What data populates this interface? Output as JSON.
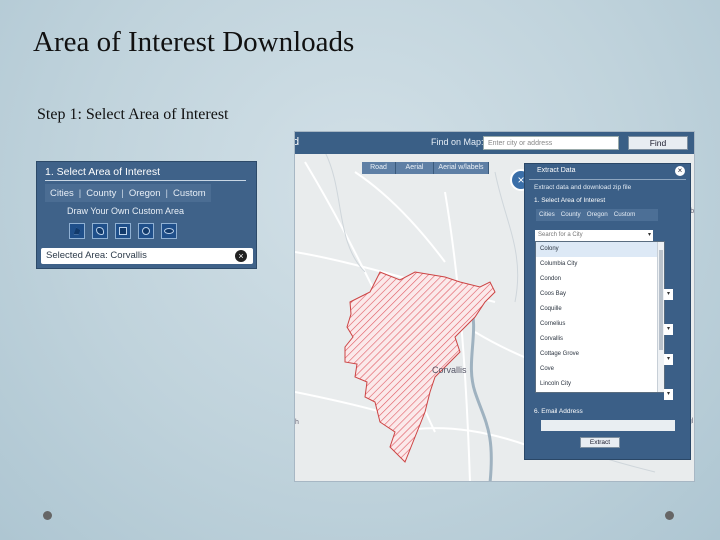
{
  "slide": {
    "title": "Area of Interest Downloads",
    "step": "Step 1: Select Area of Interest"
  },
  "snippet": {
    "header": "1. Select Area of Interest",
    "tabs": [
      "Cities",
      "County",
      "Oregon",
      "Custom"
    ],
    "draw_label": "Draw Your Own Custom Area",
    "tools": [
      "polygon-tool-icon",
      "freehand-tool-icon",
      "rectangle-tool-icon",
      "circle-tool-icon",
      "ellipse-tool-icon"
    ],
    "selected": "Selected Area: Corvallis",
    "clear": "×"
  },
  "map": {
    "title_fragment": "d",
    "find_label": "Find on Map:",
    "find_placeholder": "Enter city or address",
    "find_button": "Find",
    "base_tabs": [
      "Road",
      "Aerial",
      "Aerial w/labels"
    ],
    "city_label": "Corvallis",
    "edge_labels": {
      "right1": "Alb",
      "left1": "h",
      "right2": "ugl"
    }
  },
  "panel": {
    "title": "Extract Data",
    "subtitle": "Extract data and download zip file",
    "step1": "1. Select Area of Interest",
    "tabs": [
      "Cities",
      "County",
      "Oregon",
      "Custom"
    ],
    "search_placeholder": "Search for a City",
    "dropdown": "▾",
    "cities": [
      "Colony",
      "Columbia City",
      "Condon",
      "Coos Bay",
      "Coquille",
      "Cornelius",
      "Corvallis",
      "Cottage Grove",
      "Cove",
      "Lincoln City"
    ],
    "email_label": "6. Email Address",
    "extract_button": "Extract",
    "close": "×"
  }
}
